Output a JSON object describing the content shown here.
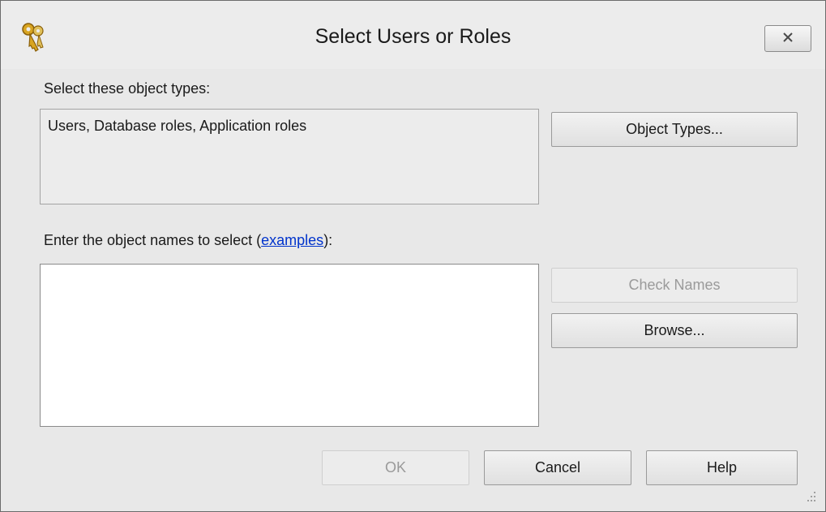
{
  "window": {
    "title": "Select Users or Roles",
    "icon": "keys-icon",
    "close_icon": "close-icon"
  },
  "object_types": {
    "label": "Select these object types:",
    "value": "Users, Database roles, Application roles",
    "button": "Object Types..."
  },
  "object_names": {
    "label_prefix": "Enter the object names to select (",
    "link_text": "examples",
    "label_suffix": "):",
    "value": "",
    "check_names_button": "Check Names",
    "browse_button": "Browse..."
  },
  "footer": {
    "ok_button": "OK",
    "cancel_button": "Cancel",
    "help_button": "Help"
  },
  "colors": {
    "dialog_background": "#e8e8e8",
    "link": "#0033cc",
    "disabled_text": "#9a9a9a"
  }
}
